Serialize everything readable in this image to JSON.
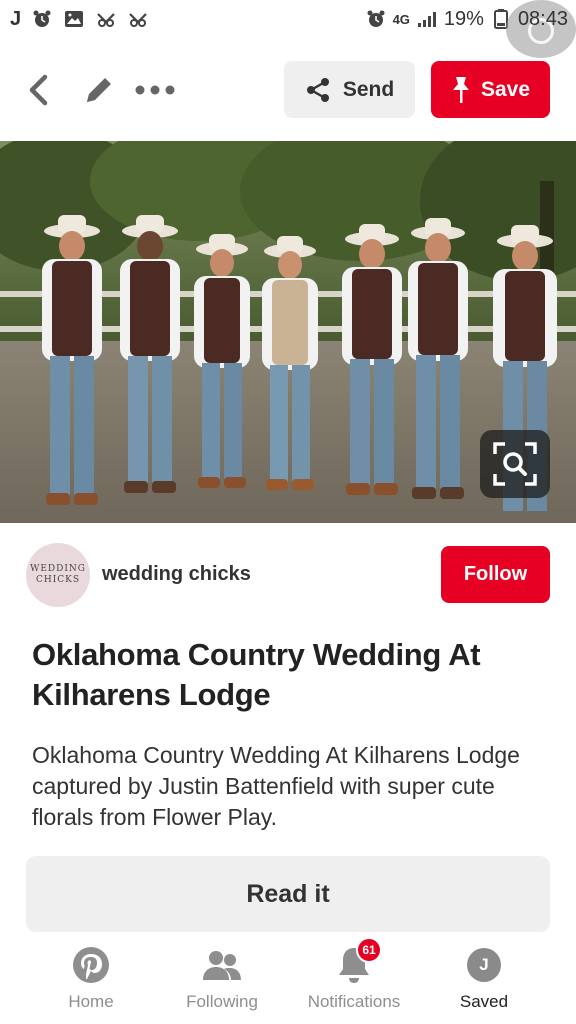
{
  "status_bar": {
    "left_letter": "J",
    "left_icons": [
      "alarm-icon",
      "image-icon",
      "voicemail-icon",
      "voicemail-icon"
    ],
    "right_icons": [
      "alarm-icon",
      "4g-signal-icon",
      "battery-icon"
    ],
    "network": "4G",
    "battery": "19%",
    "time": "08:43"
  },
  "toolbar": {
    "send_label": "Send",
    "save_label": "Save"
  },
  "pin": {
    "image_desc_icon": "visual-search-icon",
    "creator": {
      "avatar_line1": "WEDDING",
      "avatar_line2": "CHICKS",
      "name": "wedding chicks",
      "follow_label": "Follow"
    },
    "title": "Oklahoma Country Wedding At Kilharens Lodge",
    "description": "Oklahoma Country Wedding At Kilharens Lodge captured by Justin Battenfield with super cute florals from Flower Play.",
    "read_label": "Read it"
  },
  "bottom_nav": {
    "items": [
      {
        "label": "Home",
        "icon": "pinterest-icon"
      },
      {
        "label": "Following",
        "icon": "people-icon"
      },
      {
        "label": "Notifications",
        "icon": "bell-icon",
        "badge": "61"
      },
      {
        "label": "Saved",
        "icon": "profile-avatar-icon",
        "avatar_letter": "J"
      }
    ]
  },
  "colors": {
    "brand_red": "#e60023",
    "button_gray": "#efefef"
  }
}
